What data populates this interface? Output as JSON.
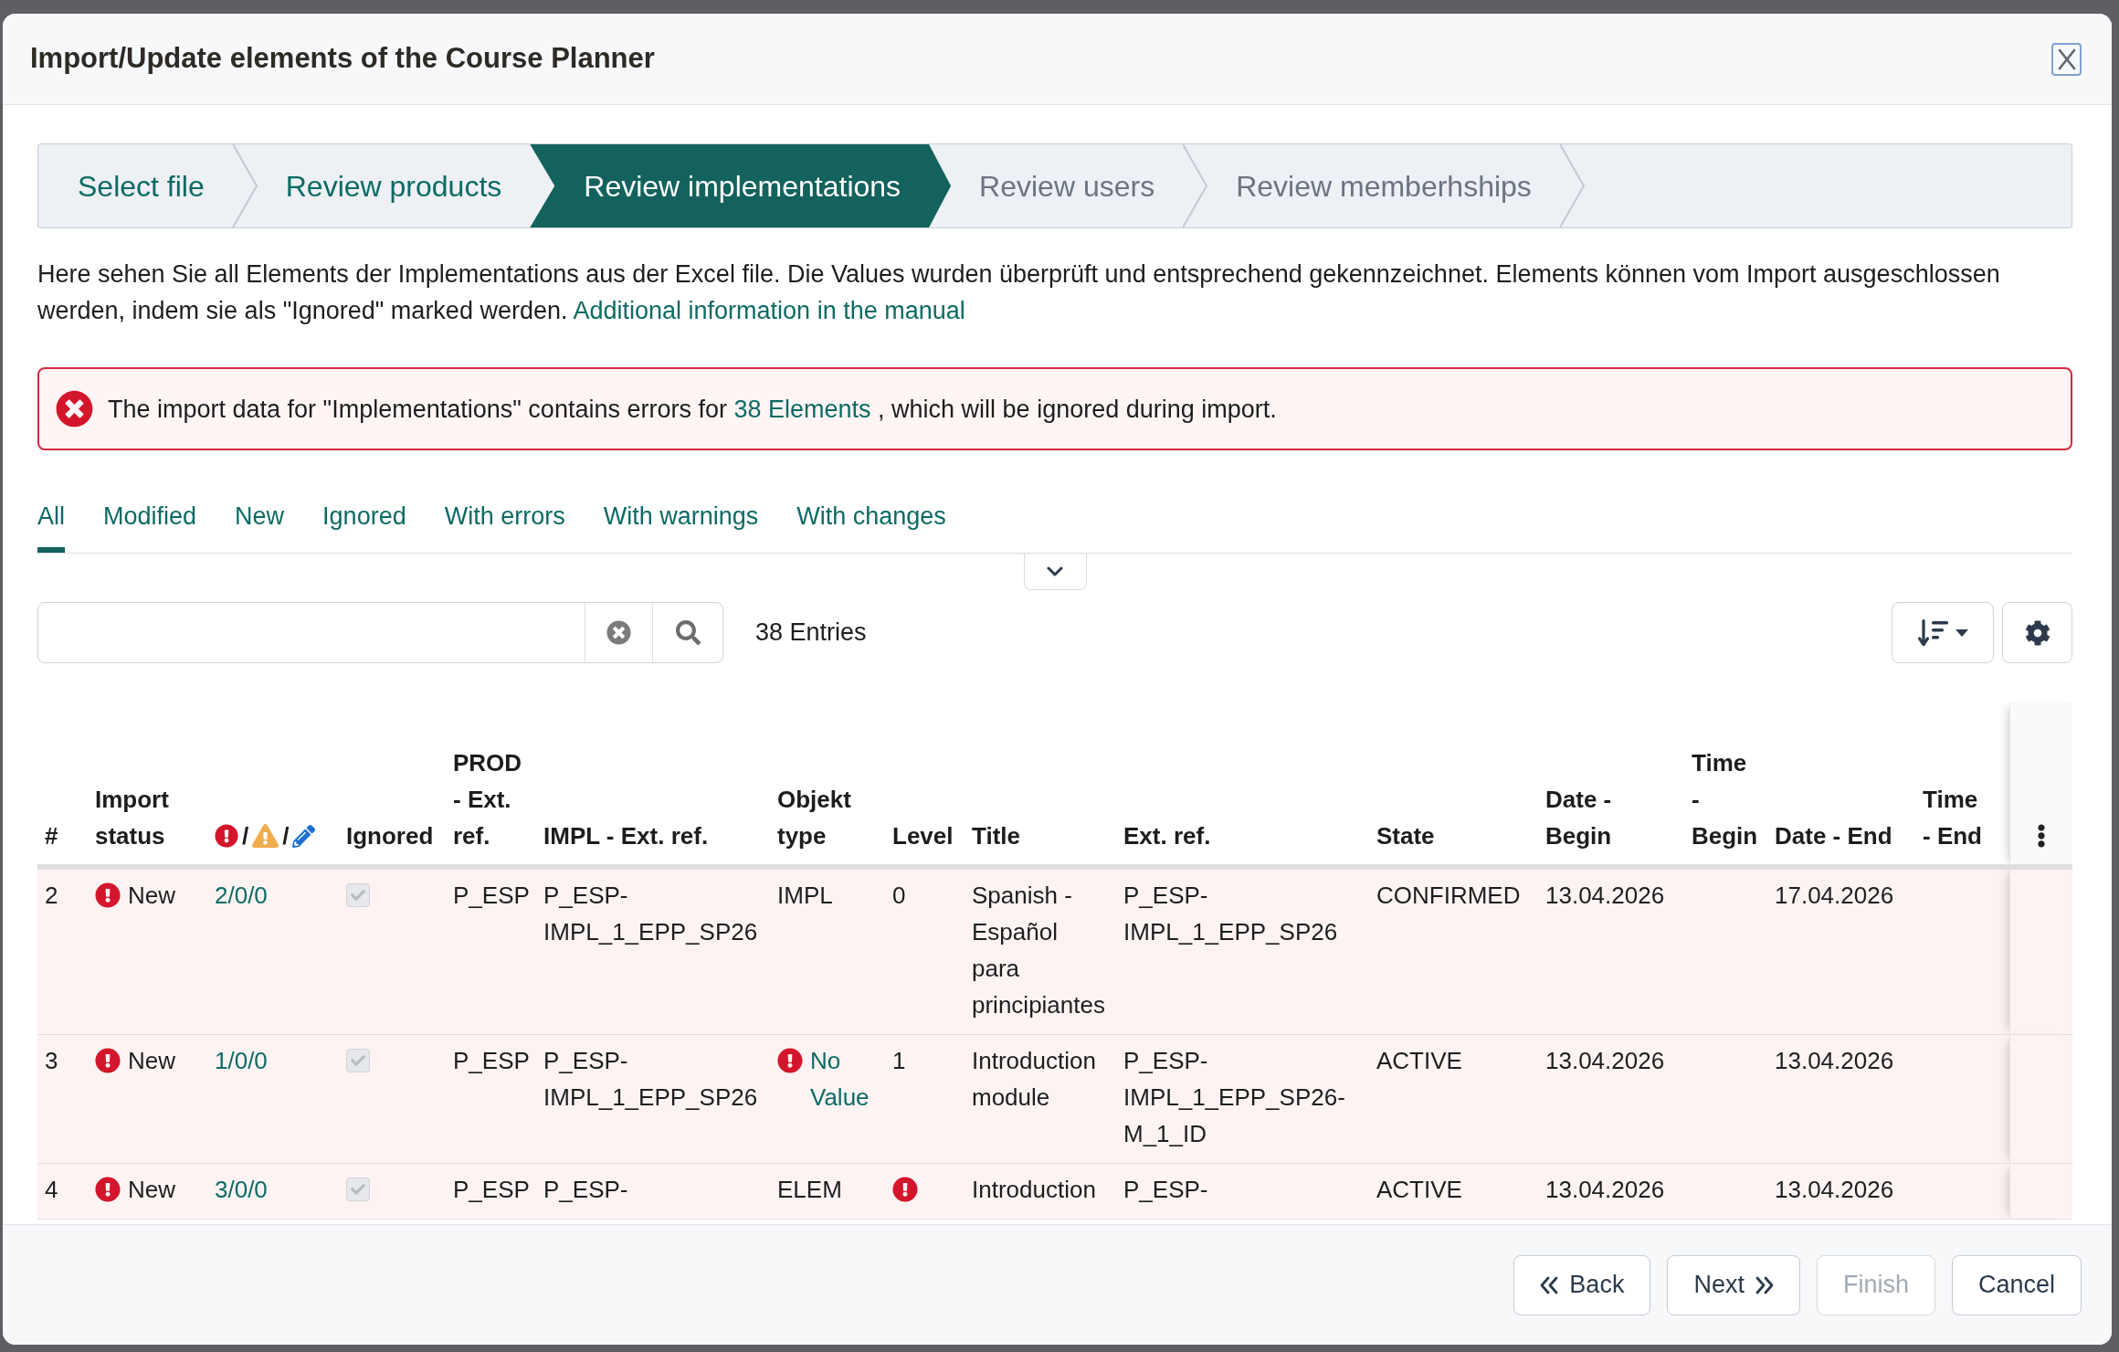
{
  "dialog": {
    "title": "Import/Update elements of the Course Planner"
  },
  "steps": [
    {
      "label": "Select file",
      "completed": true,
      "selected": false
    },
    {
      "label": "Review products",
      "completed": true,
      "selected": false
    },
    {
      "label": "Review implementations",
      "completed": false,
      "selected": true
    },
    {
      "label": "Review users",
      "completed": false,
      "selected": false
    },
    {
      "label": "Review memberhships",
      "completed": false,
      "selected": false
    }
  ],
  "description": {
    "text": "Here sehen Sie all Elements der Implementations aus der Excel file. Die Values wurden überprüft und entsprechend gekennzeichnet. Elements können vom Import ausgeschlossen werden, indem sie als \"Ignored\" marked werden.",
    "link": "Additional information in the manual"
  },
  "alert": {
    "kind": "error",
    "before": "The import data for \"Implementations\" contains errors for ",
    "link": "38 Elements",
    "after": " , which will be ignored during import."
  },
  "filter_tabs": [
    {
      "label": "All",
      "selected": true
    },
    {
      "label": "Modified",
      "selected": false
    },
    {
      "label": "New",
      "selected": false
    },
    {
      "label": "Ignored",
      "selected": false
    },
    {
      "label": "With errors",
      "selected": false
    },
    {
      "label": "With warnings",
      "selected": false
    },
    {
      "label": "With changes",
      "selected": false
    }
  ],
  "toolbar": {
    "entries": "38 Entries"
  },
  "table": {
    "columns": [
      {
        "kind": "text",
        "label": "#"
      },
      {
        "kind": "text",
        "label": "Import status"
      },
      {
        "kind": "icons",
        "separators": [
          "/",
          "/"
        ]
      },
      {
        "kind": "text",
        "label": "Ignored"
      },
      {
        "kind": "text",
        "label": "PROD - Ext. ref."
      },
      {
        "kind": "text",
        "label": "IMPL - Ext. ref."
      },
      {
        "kind": "text",
        "label": "Objekt type"
      },
      {
        "kind": "text",
        "label": "Level"
      },
      {
        "kind": "text",
        "label": "Title"
      },
      {
        "kind": "text",
        "label": "Ext. ref."
      },
      {
        "kind": "text",
        "label": "State"
      },
      {
        "kind": "text",
        "label": "Date - Begin"
      },
      {
        "kind": "text",
        "label": "Time - Begin"
      },
      {
        "kind": "text",
        "label": "Date - End"
      },
      {
        "kind": "text",
        "label": "Time - End"
      },
      {
        "kind": "menu"
      }
    ],
    "rows": [
      {
        "has_errors": true,
        "number": "2",
        "status": {
          "kind": "error",
          "label": "New"
        },
        "counts": "2/0/0",
        "ignored": {
          "checked": true,
          "disabled": true
        },
        "prod_ref": "P_ESP",
        "impl_ref": "P_ESP-IMPL_1_EPP_SP26",
        "object_type": {
          "kind": "text",
          "text": "IMPL"
        },
        "level": {
          "kind": "text",
          "text": "0"
        },
        "title": "Spanish - Español para principiantes",
        "ext_ref": "P_ESP-IMPL_1_EPP_SP26",
        "state": "CONFIRMED",
        "date_begin": "13.04.2026",
        "date_end": "17.04.2026"
      },
      {
        "has_errors": true,
        "number": "3",
        "status": {
          "kind": "error",
          "label": "New"
        },
        "counts": "1/0/0",
        "ignored": {
          "checked": true,
          "disabled": true
        },
        "prod_ref": "P_ESP",
        "impl_ref": "P_ESP-IMPL_1_EPP_SP26",
        "object_type": {
          "kind": "error",
          "text": "No Value"
        },
        "level": {
          "kind": "text",
          "text": "1"
        },
        "title": "Introduction module",
        "ext_ref": "P_ESP-IMPL_1_EPP_SP26-M_1_ID",
        "state": "ACTIVE",
        "date_begin": "13.04.2026",
        "date_end": "13.04.2026"
      },
      {
        "has_errors": true,
        "number": "4",
        "status": {
          "kind": "error",
          "label": "New"
        },
        "counts": "3/0/0",
        "ignored": {
          "checked": true,
          "disabled": true
        },
        "prod_ref": "P_ESP",
        "impl_ref": "P_ESP-",
        "object_type": {
          "kind": "text",
          "text": "ELEM"
        },
        "level": {
          "kind": "error"
        },
        "title": "Introduction",
        "ext_ref": "P_ESP-",
        "state": "ACTIVE",
        "date_begin": "13.04.2026",
        "date_end": "13.04.2026"
      }
    ]
  },
  "footer_buttons": [
    {
      "kind": "back",
      "label": "Back",
      "disabled": false
    },
    {
      "kind": "next",
      "label": "Next",
      "disabled": false
    },
    {
      "kind": "finish",
      "label": "Finish",
      "disabled": true
    },
    {
      "kind": "cancel",
      "label": "Cancel",
      "disabled": false
    }
  ]
}
